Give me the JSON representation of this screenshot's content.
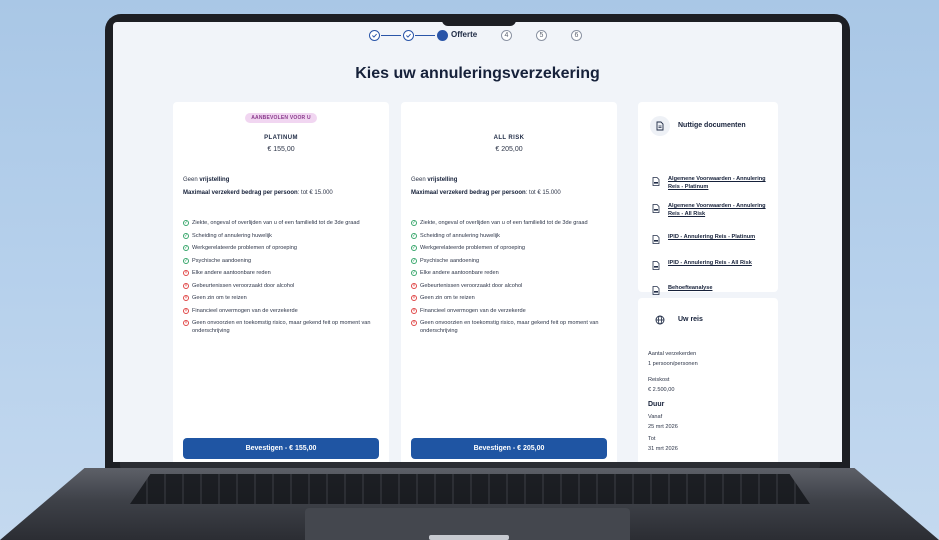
{
  "stepper": {
    "steps": [
      {
        "state": "done",
        "label": ""
      },
      {
        "state": "done",
        "label": ""
      },
      {
        "state": "active",
        "label": "Offerte"
      },
      {
        "state": "todo",
        "label": "4"
      },
      {
        "state": "todo",
        "label": "5"
      },
      {
        "state": "todo",
        "label": "6"
      }
    ],
    "accent_color": "#2a55a8"
  },
  "page_title": "Kies uw annuleringsverzekering",
  "plans": [
    {
      "badge": "AANBEVOLEN VOOR U",
      "name": "PLATINUM",
      "price": "€ 155,00",
      "deductible_prefix": "Geen ",
      "deductible_bold": "vrijstelling",
      "max_label": "Maximaal verzekerd bedrag per persoon",
      "max_value": ": tot € 15.000",
      "features": [
        {
          "covered": true,
          "text": "Ziekte, ongeval of overlijden van u of een familielid tot de 3de graad"
        },
        {
          "covered": true,
          "text": "Scheiding of annulering huwelijk"
        },
        {
          "covered": true,
          "text": "Werkgerelateerde problemen of oproeping"
        },
        {
          "covered": true,
          "text": "Psychische aandoening"
        },
        {
          "covered": false,
          "text": "Elke andere aantoonbare reden"
        },
        {
          "covered": false,
          "text": "Gebeurtenissen veroorzaakt door alcohol"
        },
        {
          "covered": false,
          "text": "Geen zin om te reizen"
        },
        {
          "covered": false,
          "text": "Financieel onvermogen van de verzekerde"
        },
        {
          "covered": false,
          "text": "Geen onvoorzien en toekomstig risico, maar gekend feit op moment van onderschrijving"
        }
      ],
      "button": "Bevestigen - € 155,00"
    },
    {
      "badge": "",
      "name": "ALL RISK",
      "price": "€ 205,00",
      "deductible_prefix": "Geen ",
      "deductible_bold": "vrijstelling",
      "max_label": "Maximaal verzekerd bedrag per persoon",
      "max_value": ": tot € 15.000",
      "features": [
        {
          "covered": true,
          "text": "Ziekte, ongeval of overlijden van u of een familielid tot de 3de graad"
        },
        {
          "covered": true,
          "text": "Scheiding of annulering huwelijk"
        },
        {
          "covered": true,
          "text": "Werkgerelateerde problemen of oproeping"
        },
        {
          "covered": true,
          "text": "Psychische aandoening"
        },
        {
          "covered": true,
          "text": "Elke andere aantoonbare reden"
        },
        {
          "covered": false,
          "text": "Gebeurtenissen veroorzaakt door alcohol"
        },
        {
          "covered": false,
          "text": "Geen zin om te reizen"
        },
        {
          "covered": false,
          "text": "Financieel onvermogen van de verzekerde"
        },
        {
          "covered": false,
          "text": "Geen onvoorzien en toekomstig risico, maar gekend feit op moment van onderschrijving"
        }
      ],
      "button": "Bevestigen - € 205,00"
    }
  ],
  "documents": {
    "title": "Nuttige documenten",
    "items": [
      "Algemene Voorwaarden - Annulering Reis - Platinum",
      "Algemene Voorwaarden - Annulering Reis - All Risk",
      "IPID - Annulering Reis - Platinum",
      "IPID - Annulering Reis - All Risk",
      "Behoefteanalyse"
    ]
  },
  "trip": {
    "title": "Uw reis",
    "insured_label": "Aantal verzekerden",
    "insured_value": "1 persoon/personen",
    "cost_label": "Reiskost",
    "cost_value": "€ 2.500,00",
    "duration_label": "Duur",
    "from_label": "Vanaf",
    "from_value": "25 mrt 2026",
    "to_label": "Tot",
    "to_value": "31 mrt 2026"
  },
  "colors": {
    "primary_button": "#1f55a3",
    "badge_bg": "#f1d6f1",
    "covered": "#3aa76d",
    "not_covered": "#e04848"
  }
}
